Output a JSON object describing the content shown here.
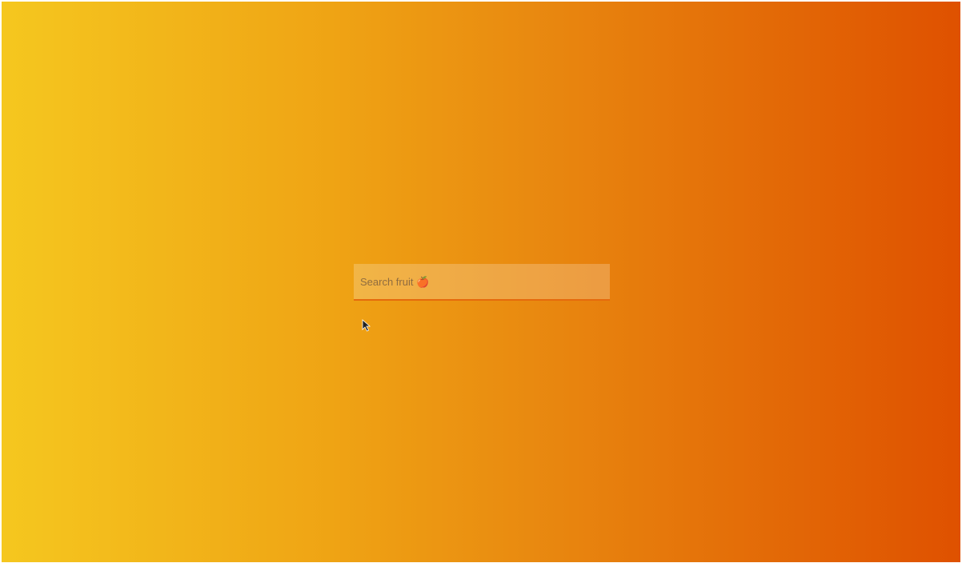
{
  "search": {
    "placeholder": "Search fruit 🍎"
  },
  "cursor": {
    "icon": "mouse-pointer-icon"
  },
  "colors": {
    "gradient_start": "#f5c71f",
    "gradient_end": "#df5100",
    "input_underline": "#e56a0c"
  }
}
